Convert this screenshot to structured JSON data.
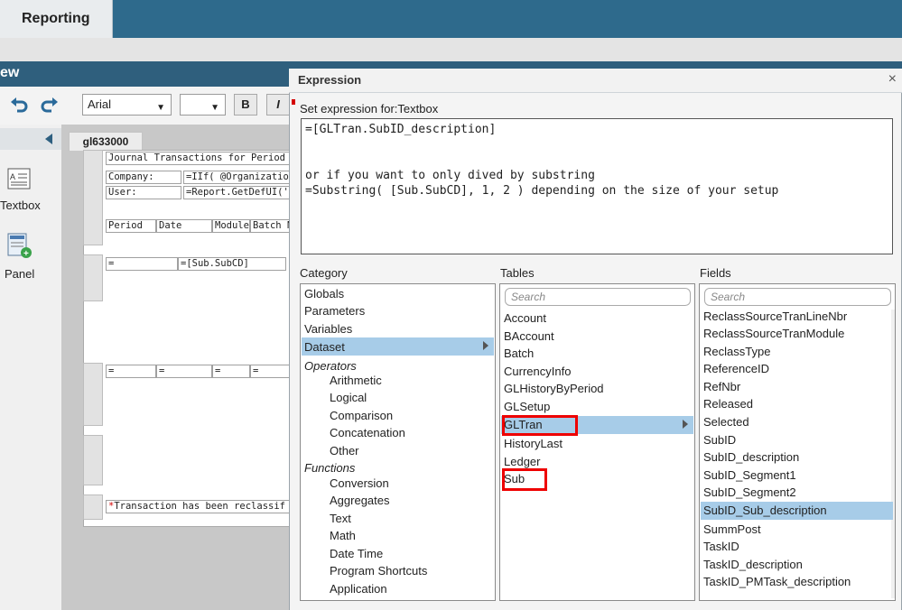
{
  "app": {
    "tab_label": "Reporting",
    "designer_title": "ew"
  },
  "toolbar": {
    "undo_icon": "undo-icon",
    "redo_icon": "redo-icon",
    "font_family": "Arial",
    "font_size": "",
    "bold_label": "B",
    "italic_label": "I"
  },
  "left_panel": {
    "tools": [
      {
        "label": "Textbox",
        "icon": "textbox-icon"
      },
      {
        "label": "Panel",
        "icon": "panel-icon"
      }
    ]
  },
  "canvas": {
    "doc_tab": "gl633000",
    "cells": {
      "title": "Journal Transactions for Period",
      "company_label": "Company:",
      "company_value": "=IIf( @Organizatio",
      "user_label": "User:",
      "user_value": "=Report.GetDefUI('",
      "col_period": "Period",
      "col_date": "Date",
      "col_module": "Module",
      "col_batch": "Batch N",
      "detail_eq": "=",
      "detail_subcd": "=[Sub.SubCD]",
      "eq1": "=",
      "eq2": "=",
      "eq3": "=",
      "eq4": "=",
      "footer_note": "Transaction has been reclassif",
      "footer_marker": "*"
    }
  },
  "dialog": {
    "title": "Expression",
    "close": "×",
    "expr_label": "Set expression for:Textbox",
    "expression": "=[GLTran.SubID_description]\n\n\nor if you want to only dived by substring\n=Substring( [Sub.SubCD], 1, 2 ) depending on the size of your setup",
    "category": {
      "label": "Category",
      "items": [
        {
          "label": "Globals",
          "style": "normal"
        },
        {
          "label": "Parameters",
          "style": "normal"
        },
        {
          "label": "Variables",
          "style": "normal"
        },
        {
          "label": "Dataset",
          "style": "selected"
        },
        {
          "label": "Operators",
          "style": "italic"
        },
        {
          "label": "Arithmetic",
          "style": "indent"
        },
        {
          "label": "Logical",
          "style": "indent"
        },
        {
          "label": "Comparison",
          "style": "indent"
        },
        {
          "label": "Concatenation",
          "style": "indent"
        },
        {
          "label": "Other",
          "style": "indent"
        },
        {
          "label": "Functions",
          "style": "italic"
        },
        {
          "label": "Conversion",
          "style": "indent"
        },
        {
          "label": "Aggregates",
          "style": "indent"
        },
        {
          "label": "Text",
          "style": "indent"
        },
        {
          "label": "Math",
          "style": "indent"
        },
        {
          "label": "Date Time",
          "style": "indent"
        },
        {
          "label": "Program Shortcuts",
          "style": "indent"
        },
        {
          "label": "Application",
          "style": "indent"
        }
      ]
    },
    "tables": {
      "label": "Tables",
      "search_placeholder": "Search",
      "items": [
        "Account",
        "BAccount",
        "Batch",
        "CurrencyInfo",
        "GLHistoryByPeriod",
        "GLSetup",
        "GLTran",
        "HistoryLast",
        "Ledger",
        "Sub"
      ],
      "selected": "GLTran"
    },
    "fields": {
      "label": "Fields",
      "search_placeholder": "Search",
      "items": [
        "ReclassSourceTranLineNbr",
        "ReclassSourceTranModule",
        "ReclassType",
        "ReferenceID",
        "RefNbr",
        "Released",
        "Selected",
        "SubID",
        "SubID_description",
        "SubID_Segment1",
        "SubID_Segment2",
        "SubID_Sub_description",
        "SummPost",
        "TaskID",
        "TaskID_description",
        "TaskID_PMTask_description"
      ],
      "selected": "SubID_Sub_description"
    }
  },
  "colors": {
    "accent": "#2e6a8c",
    "selection": "#a7cce8",
    "highlight_box": "#e00000"
  }
}
